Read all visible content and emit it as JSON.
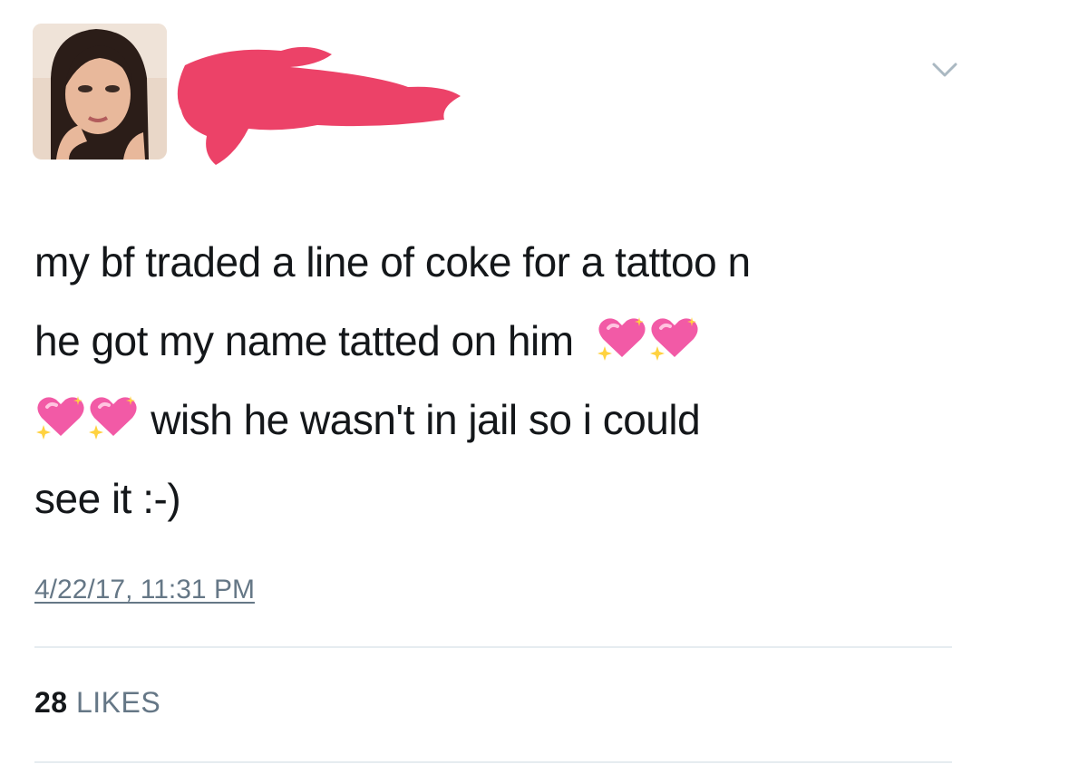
{
  "tweet": {
    "lines": [
      "my bf traded a line of coke for a tattoo n",
      "he got my name tatted on him",
      "wish he wasn't in jail so i could",
      "see it :-)"
    ],
    "emoji": "sparkling-heart",
    "timestamp": "4/22/17, 11:31 PM"
  },
  "stats": {
    "likes_count": "28",
    "likes_label": "LIKES"
  },
  "icons": {
    "menu": "chevron-down-icon",
    "avatar": "profile-photo",
    "redaction": "red-scribble-redaction"
  },
  "colors": {
    "text": "#14171a",
    "muted": "#657786",
    "divider": "#e6ecf0",
    "redaction": "#ec4268",
    "heart": "#f25aa6"
  }
}
